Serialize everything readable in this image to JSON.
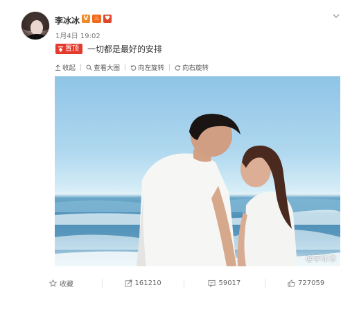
{
  "user": {
    "name": "李冰冰",
    "badges": [
      "V",
      "♨",
      "♥"
    ],
    "time": "1月4日 19:02"
  },
  "post": {
    "pin_label": "置顶",
    "text": "一切都是最好的安排"
  },
  "toolbar": {
    "collapse": "收起",
    "view_large": "查看大图",
    "rotate_left": "向左旋转",
    "rotate_right": "向右旋转"
  },
  "photo": {
    "watermark": "@李冰冰"
  },
  "actions": {
    "favorite": "收藏",
    "repost_count": "161210",
    "comment_count": "59017",
    "like_count": "727059"
  },
  "colors": {
    "pin_red": "#e33a2c",
    "badge_orange": "#f28b24",
    "text_dark": "#333333",
    "text_muted": "#777777"
  }
}
